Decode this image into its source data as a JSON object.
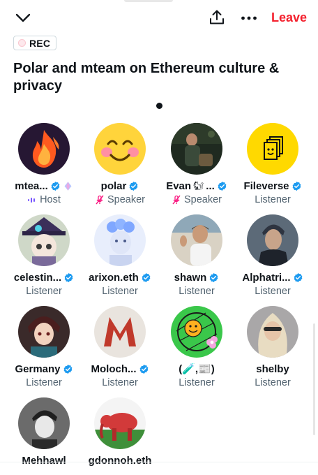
{
  "header": {
    "collapse_icon": "chevron-down-icon",
    "share_icon": "share-upload-icon",
    "more_icon": "more-dots-icon",
    "leave_label": "Leave",
    "leave_color": "#f4212e"
  },
  "rec": {
    "label": "REC"
  },
  "space": {
    "title": "Polar and mteam on Ethereum culture & privacy"
  },
  "colors": {
    "verified": "#1d9bf0",
    "speaker_icon": "#f91880",
    "host_icon": "#7856ff"
  },
  "participants": [
    {
      "name": "mtea...",
      "role": "Host",
      "verified": true,
      "badge": "diamond-icon",
      "role_icon": "host-audio-icon"
    },
    {
      "name": "polar",
      "role": "Speaker",
      "verified": true,
      "role_icon": "mic-muted-icon"
    },
    {
      "name": "Evan",
      "suffix": "...",
      "emoji": "🐿",
      "role": "Speaker",
      "verified": true,
      "role_icon": "mic-muted-icon"
    },
    {
      "name": "Fileverse",
      "role": "Listener",
      "verified": true
    },
    {
      "name": "celestin...",
      "role": "Listener",
      "verified": true
    },
    {
      "name": "arixon.eth",
      "role": "Listener",
      "verified": true
    },
    {
      "name": "shawn",
      "role": "Listener",
      "verified": true
    },
    {
      "name": "Alphatri...",
      "role": "Listener",
      "verified": true
    },
    {
      "name": "Germany",
      "role": "Listener",
      "verified": true
    },
    {
      "name": "Moloch...",
      "role": "Listener",
      "verified": true
    },
    {
      "name": "(🧪,📰)",
      "role": "Listener",
      "verified": false
    },
    {
      "name": "shelby",
      "role": "Listener",
      "verified": false
    },
    {
      "name": "Mehhawl",
      "role": "",
      "verified": false
    },
    {
      "name": "gdonnoh.eth",
      "role": "",
      "verified": false
    }
  ]
}
